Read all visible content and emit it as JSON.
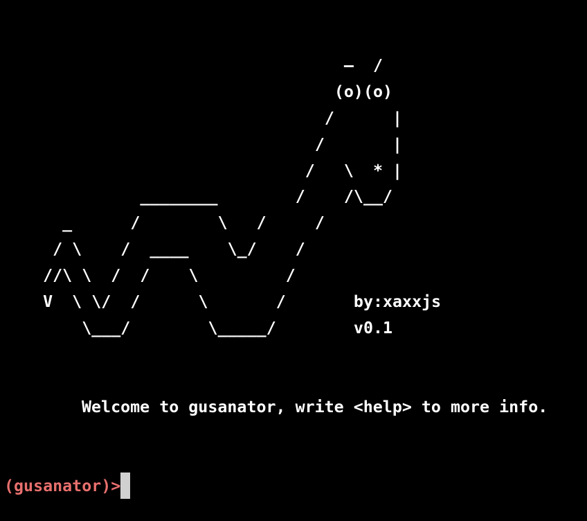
{
  "banner": {
    "art_lines": [
      "                                   ‒  /",
      "                                  (o)(o)",
      "                                 /      |",
      "                                /       |",
      "                               /   \\  * |",
      "              ________        /    /\\__/",
      "      _      /        \\   /     /",
      "     / \\    /  ____    \\_/    /",
      "    //\\ \\  /  /    \\         /",
      "    V  \\ \\/  /      \\       /       by:xaxxjs",
      "        \\___/        \\_____/        v0.1"
    ]
  },
  "welcome_message": "Welcome to gusanator, write <help> to more info.",
  "prompt": {
    "text": "(gusanator)>",
    "color": "#e8706e",
    "input_value": ""
  }
}
